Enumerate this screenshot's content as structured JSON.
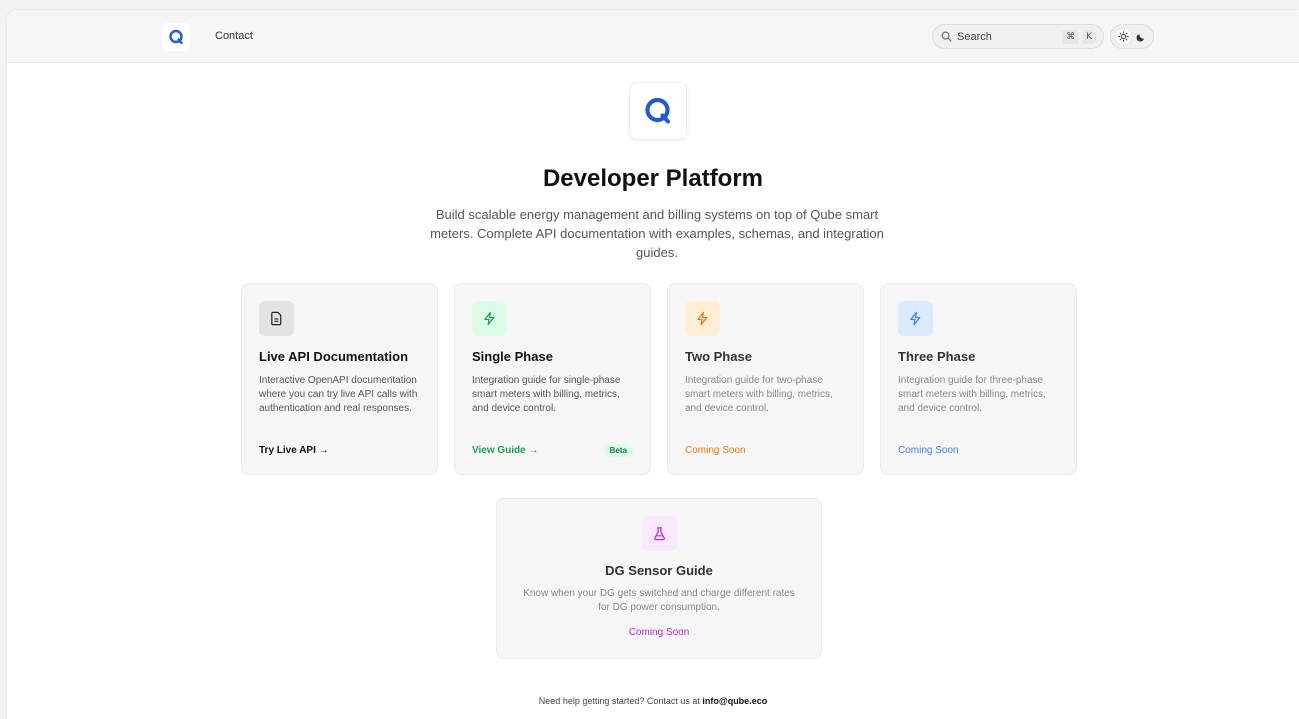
{
  "header": {
    "nav_contact": "Contact",
    "search_placeholder": "Search",
    "shortcut_mod": "⌘",
    "shortcut_key": "K"
  },
  "hero": {
    "title": "Developer Platform",
    "description": "Build scalable energy management and billing systems on top of Qube smart meters. Complete API documentation with examples, schemas, and integration guides."
  },
  "cards": [
    {
      "title": "Live API Documentation",
      "description": "Interactive OpenAPI documentation where you can try live API calls with authentication and real responses.",
      "link": "Try Live API →",
      "icon": "document-icon",
      "accent": "#111111"
    },
    {
      "title": "Single Phase",
      "description": "Integration guide for single-phase smart meters with billing, metrics, and device control.",
      "link": "View Guide →",
      "badge": "Beta",
      "icon": "bolt-icon",
      "accent": "#16a34a"
    },
    {
      "title": "Two Phase",
      "description": "Integration guide for two-phase smart meters with billing, metrics, and device control.",
      "link": "Coming Soon",
      "icon": "bolt-icon",
      "accent": "#f97316"
    },
    {
      "title": "Three Phase",
      "description": "Integration guide for three-phase smart meters with billing, metrics, and device control.",
      "link": "Coming Soon",
      "icon": "bolt-icon",
      "accent": "#3b82f6"
    },
    {
      "title": "DG Sensor Guide",
      "description": "Know when your DG gets switched and charge different rates for DG power consumption.",
      "link": "Coming Soon",
      "icon": "flask-icon",
      "accent": "#c026d3"
    }
  ],
  "footer": {
    "text": "Need help getting started? Contact us at",
    "email": "info@qube.eco"
  },
  "colors": {
    "brand": "#1e5bd8"
  }
}
